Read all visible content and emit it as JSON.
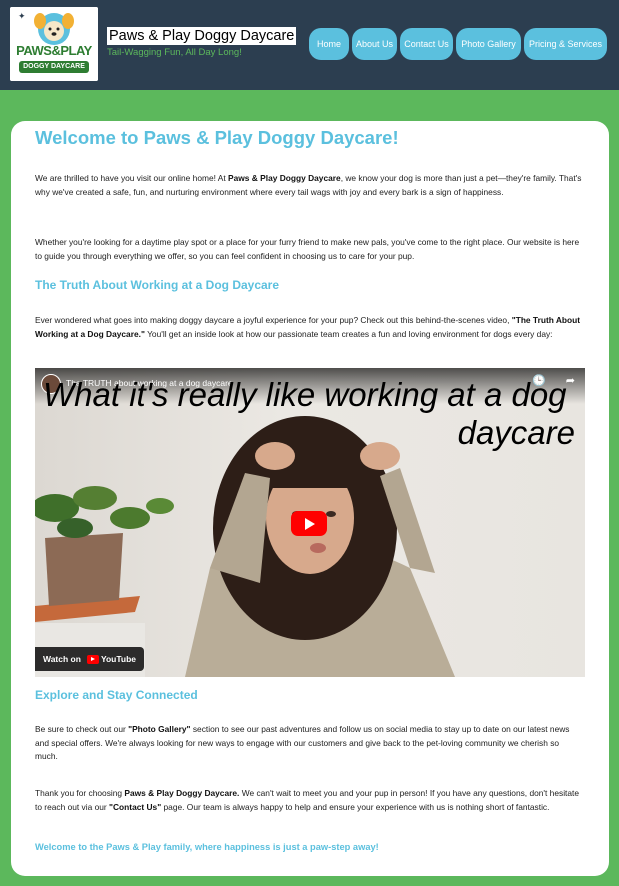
{
  "header": {
    "logo": {
      "line1": "PAWS&PLAY",
      "line2": "DOGGY DAYCARE"
    },
    "title": "Paws & Play Doggy Daycare",
    "tagline": "Tail-Wagging Fun, All Day Long!",
    "nav": [
      "Home",
      "About Us",
      "Contact Us",
      "Photo Gallery",
      "Pricing & Services"
    ]
  },
  "main": {
    "heading": "Welcome to Paws & Play Doggy Daycare!",
    "intro": {
      "a": "We are thrilled to have you visit our online home! At ",
      "b": "Paws & Play Doggy Daycare",
      "c": ", we know your dog is more than just a pet—they're family. That's why we've created a safe, fun, and nurturing environment where every tail wags with joy and every bark is a sign of happiness."
    },
    "intro2": "Whether you're looking for a daytime play spot or a place for your furry friend to make new pals, you've come to the right place. Our website is here to guide you through everything we offer, so you can feel confident in choosing us to care for your pup.",
    "section1_heading": "The Truth About Working at a Dog Daycare",
    "section1": {
      "a": "Ever wondered what goes into making doggy daycare a joyful experience for your pup? Check out this behind-the-scenes video, ",
      "b": "\"The Truth About Working at a Dog Daycare.\"",
      "c": " You'll get an inside look at how our passionate team creates a fun and loving environment for dogs every day:"
    },
    "video": {
      "title": "The TRUTH about working at a dog daycare",
      "caption_line1": "What it's really like working at a dog",
      "caption_line2": "daycare",
      "watch_on": "Watch on",
      "youtube": "YouTube"
    },
    "section2_heading": "Explore and Stay Connected",
    "section2": {
      "a": "Be sure to check out our ",
      "b": "\"Photo Gallery\"",
      "c": " section to see our past adventures and follow us on social media to stay up to date on our latest news and special offers. We're always looking for new ways to engage with our customers and give back to the pet-loving community we cherish so much."
    },
    "thanks": {
      "a": "Thank you for choosing ",
      "b": "Paws & Play Doggy Daycare.",
      "c": " We can't wait to meet you and your pup in person! If you have any questions, don't hesitate to reach out via our ",
      "d": "\"Contact Us\"",
      "e": " page. Our team is always happy to help and ensure your experience with us is nothing short of fantastic."
    },
    "closing": {
      "a": "Welcome to the ",
      "b": "Paws & Play",
      "c": " family, where happiness is just a paw-step away!"
    }
  },
  "colors": {
    "header_bg": "#2c3e50",
    "page_bg": "#5cb85c",
    "accent": "#5bc0de",
    "youtube_red": "#ff0000"
  }
}
